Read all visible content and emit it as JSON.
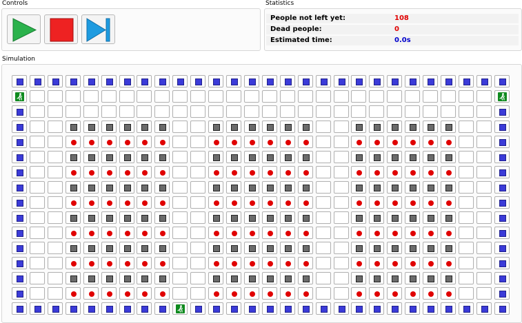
{
  "controls": {
    "label": "Controls",
    "buttons": [
      {
        "name": "play-button",
        "icon": "play-icon",
        "color": "#2bb24c"
      },
      {
        "name": "stop-button",
        "icon": "stop-icon",
        "color": "#ee2222"
      },
      {
        "name": "step-button",
        "icon": "step-forward-icon",
        "color": "#1e9be0"
      }
    ]
  },
  "statistics": {
    "label": "Statistics",
    "rows": [
      {
        "label": "People not left yet:",
        "value": "108",
        "color": "#e00000"
      },
      {
        "label": "Dead people:",
        "value": "0",
        "color": "#e00000"
      },
      {
        "label": "Estimated time:",
        "value": "0.0s",
        "color": "#0000cc"
      }
    ]
  },
  "simulation": {
    "label": "Simulation",
    "legend_colors": {
      "wall": "#3b3bd8",
      "obstacle": "#6b6b6b",
      "person": "#e00000",
      "exit": "#0f8a1f"
    },
    "grid": [
      "WWWWWWWWWWWWWWWWWWWWWWWWWWWW",
      "E..........................E",
      "W..........................W",
      "W..OOOOOO..OOOOOO..OOOOOO..W",
      "W..PPPPPP..PPPPPP..PPPPPP..W",
      "W..OOOOOO..OOOOOO..OOOOOO..W",
      "W..PPPPPP..PPPPPP..PPPPPP..W",
      "W..OOOOOO..OOOOOO..OOOOOO..W",
      "W..PPPPPP..PPPPPP..PPPPPP..W",
      "W..OOOOOO..OOOOOO..OOOOOO..W",
      "W..PPPPPP..PPPPPP..PPPPPP..W",
      "W..OOOOOO..OOOOOO..OOOOOO..W",
      "W..PPPPPP..PPPPPP..PPPPPP..W",
      "W..OOOOOO..OOOOOO..OOOOOO..W",
      "W..PPPPPP..PPPPPP..PPPPPP..W",
      "WWWWWWWWWEWWWWWWWWWWWWWWWWWW"
    ]
  }
}
